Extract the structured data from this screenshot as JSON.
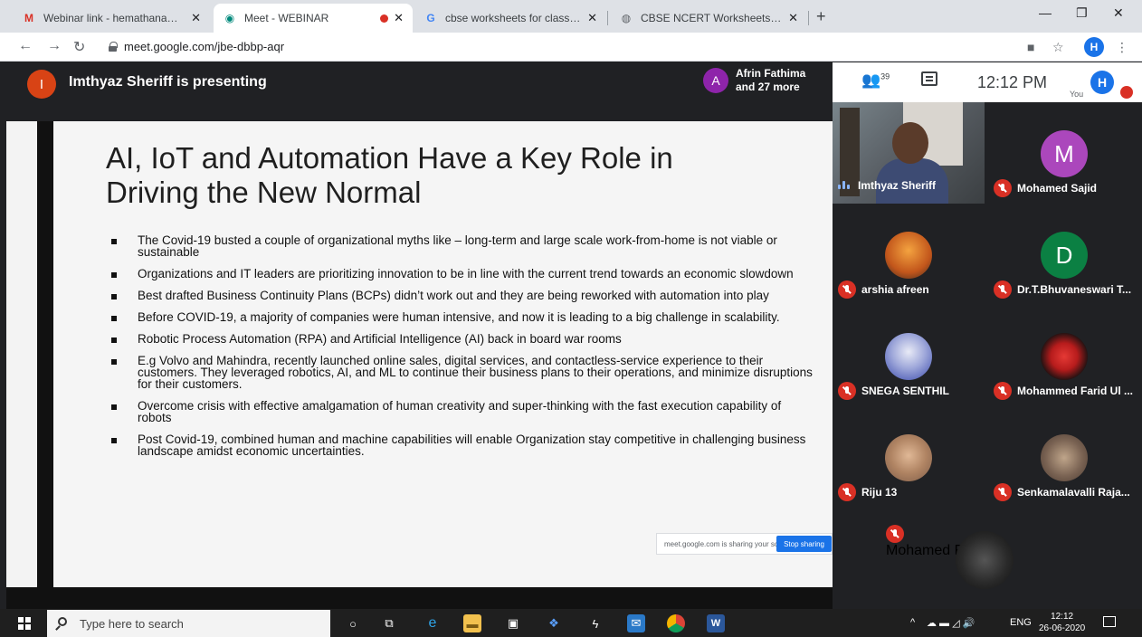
{
  "browser": {
    "tabs": [
      {
        "title": "Webinar link - hemathanam@gm",
        "favicon": "gmail-icon"
      },
      {
        "title": "Meet - WEBINAR",
        "favicon": "meet-icon"
      },
      {
        "title": "cbse worksheets for class 2 - Goo",
        "favicon": "google-icon"
      },
      {
        "title": "CBSE NCERT Worksheets for Clas",
        "favicon": "web-icon"
      }
    ],
    "url": "meet.google.com/jbe-dbbp-aqr",
    "profile_initial": "H"
  },
  "meet": {
    "presenter_initial": "I",
    "presenting_text": "Imthyaz Sheriff is presenting",
    "joiners": {
      "initial": "A",
      "name": "Afrin Fathima",
      "more": "and 27 more"
    },
    "people_count": "39",
    "time": "12:12 PM",
    "you_label": "You",
    "you_initial": "H"
  },
  "slide": {
    "title": "AI, IoT and Automation Have a Key Role in Driving the New Normal",
    "bullets": [
      "The Covid-19 busted a couple of organizational myths like – long-term and large scale work-from-home is not viable or sustainable",
      "Organizations and IT leaders are prioritizing innovation to be in line with the current trend towards an economic slowdown",
      "Best drafted Business Continuity Plans (BCPs) didn’t work out and they are being reworked with automation into play",
      "Before COVID-19, a majority of companies were human intensive, and now it is leading to a big challenge in scalability.",
      "Robotic Process Automation (RPA) and Artificial Intelligence (AI) back in board war rooms",
      "E.g Volvo and Mahindra, recently launched online sales, digital services, and contactless-service experience to their customers. They leveraged robotics, AI, and ML to continue their business plans to their operations, and minimize disruptions for their customers.",
      "Overcome crisis with effective amalgamation of human creativity and super-thinking with the fast execution capability of robots",
      "Post Covid-19, combined human and machine capabilities will enable Organization stay competitive in challenging business landscape amidst economic uncertainties."
    ],
    "share_note": "meet.google.com is sharing your screen.",
    "stop_label": "Stop sharing"
  },
  "participants": [
    {
      "name": "Imthyaz Sheriff",
      "type": "video",
      "muted": false
    },
    {
      "name": "Mohamed Sajid",
      "initial": "M",
      "color": "#ab47bc",
      "muted": true
    },
    {
      "name": "arshia afreen",
      "initial": "",
      "color": "#e57c2f",
      "muted": true
    },
    {
      "name": "Dr.T.Bhuvaneswari T...",
      "initial": "D",
      "color": "#0b8043",
      "muted": true
    },
    {
      "name": "SNEGA SENTHIL",
      "initial": "",
      "color": "#7986cb",
      "muted": true
    },
    {
      "name": "Mohammed Farid Ul ...",
      "initial": "",
      "color": "#b71c1c",
      "muted": true
    },
    {
      "name": "Riju 13",
      "initial": "",
      "color": "#c9a27e",
      "muted": true
    },
    {
      "name": "Senkamalavalli Raja...",
      "initial": "",
      "color": "#8d6e63",
      "muted": true
    },
    {
      "name": "Mohamed Fazil",
      "initial": "",
      "color": "#333333",
      "muted": true
    }
  ],
  "taskbar": {
    "search_placeholder": "Type here to search",
    "lang": "ENG",
    "time": "12:12",
    "date": "26-06-2020"
  },
  "colors": {
    "meet_bg": "#202124",
    "mic_off": "#d93025",
    "accent": "#1a73e8"
  }
}
